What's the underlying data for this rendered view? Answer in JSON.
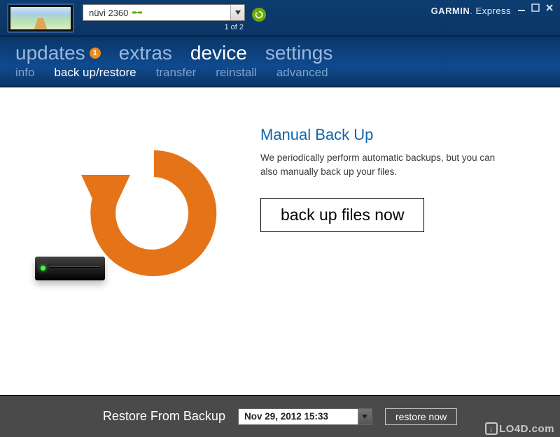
{
  "brand": {
    "name_bold": "GARMIN",
    "name_light": "Express"
  },
  "device": {
    "name": "nüvi 2360",
    "count_text": "1 of 2"
  },
  "tabs": {
    "updates": {
      "label": "updates",
      "badge": "1"
    },
    "extras": {
      "label": "extras"
    },
    "device": {
      "label": "device"
    },
    "settings": {
      "label": "settings"
    }
  },
  "subtabs": {
    "info": "info",
    "backup_restore": "back up/restore",
    "transfer": "transfer",
    "reinstall": "reinstall",
    "advanced": "advanced"
  },
  "main": {
    "title": "Manual Back Up",
    "description": "We periodically perform automatic backups, but you can also manually back up your files.",
    "button_label": "back up files now"
  },
  "footer": {
    "label": "Restore From Backup",
    "selected_date": "Nov 29, 2012 15:33",
    "restore_button": "restore now"
  },
  "watermark": "LO4D.com"
}
